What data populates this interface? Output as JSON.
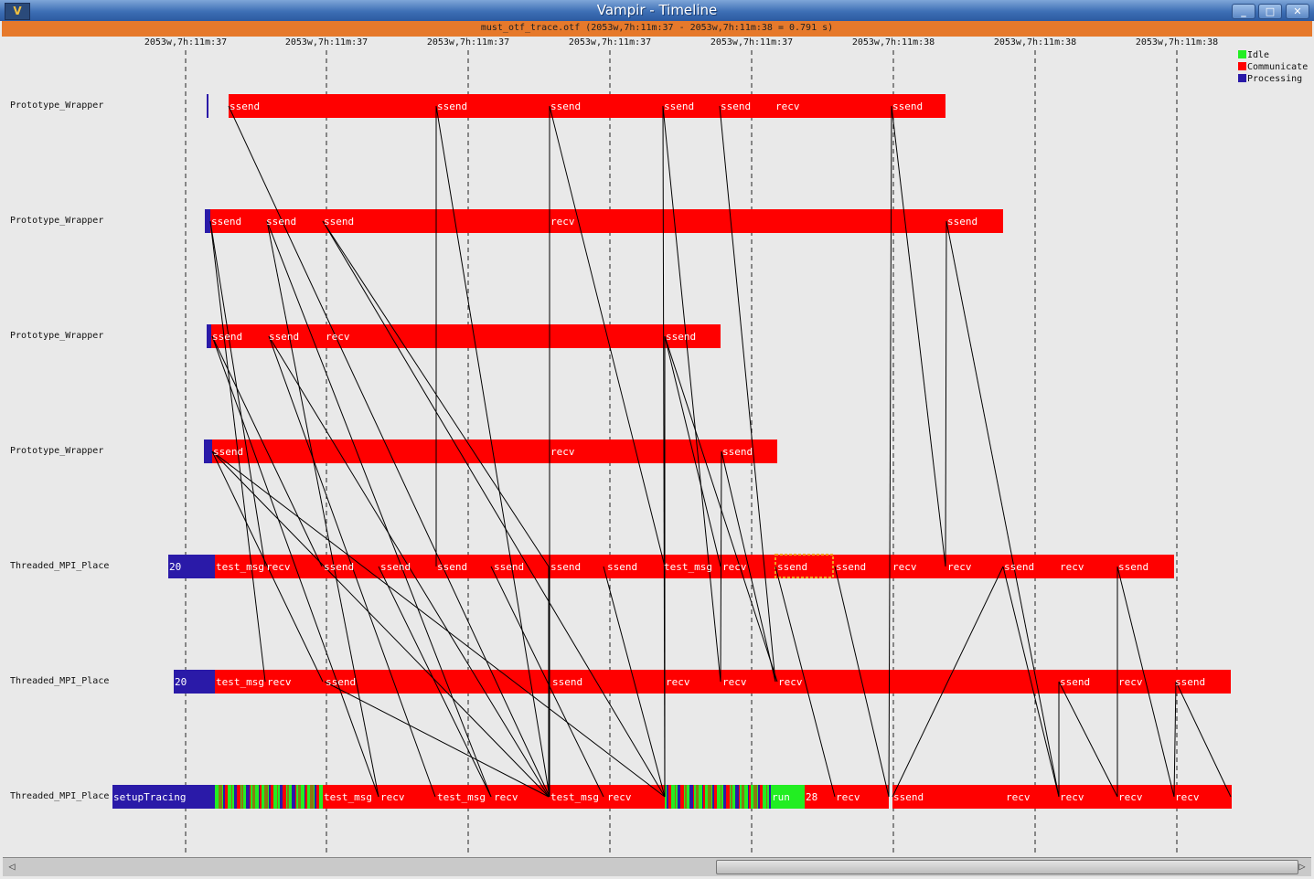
{
  "window": {
    "title": "Vampir - Timeline",
    "app_icon": "V",
    "controls": [
      "_",
      "□",
      "✕"
    ]
  },
  "info": "must_otf_trace.otf (2053w,7h:11m:37 - 2053w,7h:11m:38 = 0.791 s)",
  "time_ticks": [
    "2053w,7h:11m:37",
    "2053w,7h:11m:37",
    "2053w,7h:11m:37",
    "2053w,7h:11m:37",
    "2053w,7h:11m:37",
    "2053w,7h:11m:38",
    "2053w,7h:11m:38",
    "2053w,7h:11m:38"
  ],
  "legend": [
    {
      "label": "Idle",
      "color": "#22ee22"
    },
    {
      "label": "Communicate",
      "color": "#ff0000"
    },
    {
      "label": "Processing",
      "color": "#2a1aa8"
    }
  ],
  "processes": [
    "Prototype_Wrapper",
    "Prototype_Wrapper",
    "Prototype_Wrapper",
    "Prototype_Wrapper",
    "Threaded_MPI_Place",
    "Threaded_MPI_Place",
    "Threaded_MPI_Place"
  ],
  "labels": {
    "p0": [
      "ssend",
      "ssend",
      "ssend",
      "ssend",
      "ssend",
      "recv",
      "ssend"
    ],
    "p1": [
      "ssend",
      "ssend",
      "ssend",
      "recv",
      "ssend"
    ],
    "p2": [
      "ssend",
      "ssend",
      "recv",
      "ssend"
    ],
    "p3": [
      "ssend",
      "recv",
      "ssend"
    ],
    "p4": [
      "20",
      "test_msg",
      "recv",
      "ssend",
      "ssend",
      "ssend",
      "ssend",
      "ssend",
      "ssend",
      "test_msg",
      "recv",
      "ssend",
      "ssend",
      "recv",
      "recv",
      "ssend",
      "recv",
      "ssend"
    ],
    "p5": [
      "20",
      "test_msg",
      "recv",
      "ssend",
      "ssend",
      "recv",
      "recv",
      "recv",
      "ssend",
      "recv",
      "ssend"
    ],
    "p6": [
      "setupTracing",
      "test_msg",
      "recv",
      "test_msg",
      "recv",
      "test_msg",
      "recv",
      "run",
      "28",
      "recv",
      "ssend",
      "recv",
      "recv",
      "recv",
      "recv"
    ]
  }
}
